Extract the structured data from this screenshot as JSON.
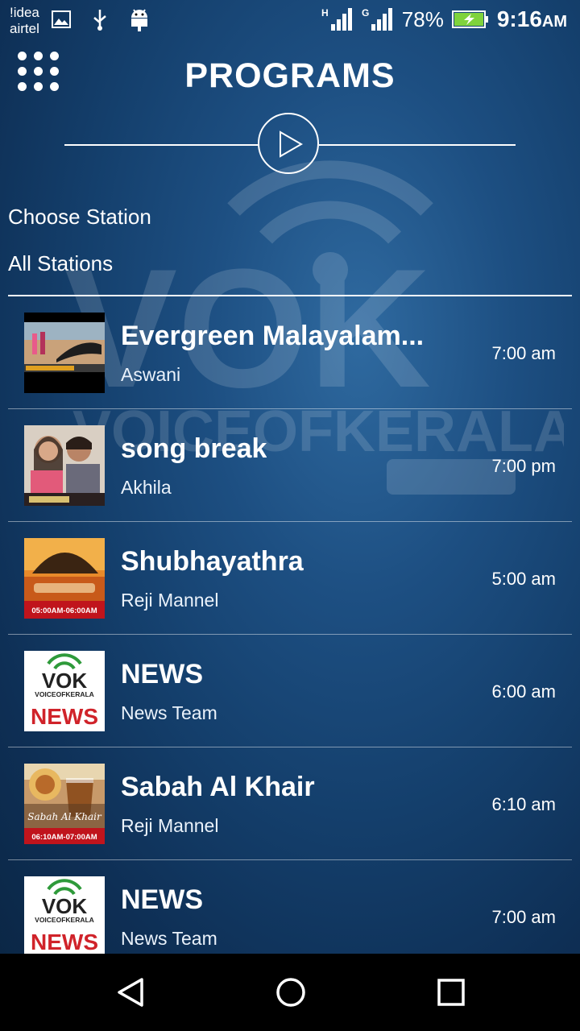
{
  "status_bar": {
    "carrier_line1": "!idea",
    "carrier_line2": "airtel",
    "network1": "H",
    "network2": "G",
    "battery_percent": "78%",
    "time": "9:16",
    "am_pm": "AM"
  },
  "header": {
    "title": "PROGRAMS"
  },
  "station": {
    "choose_label": "Choose Station",
    "selected": "All Stations"
  },
  "thumb_text": {
    "shubhayathra_time": "05:00AM-06:00AM",
    "sabah_time": "06:10AM-07:00AM",
    "sabah_name": "Sabah Al Khair",
    "vok_logo": "VOK",
    "vok_sub": "VOICEOFKERALA",
    "news_word": "NEWS"
  },
  "programs": [
    {
      "title": "Evergreen Malayalam...",
      "host": "Aswani",
      "time": "7:00 am",
      "thumb": "evergreen"
    },
    {
      "title": "song break",
      "host": "Akhila",
      "time": "7:00 pm",
      "thumb": "movie"
    },
    {
      "title": "Shubhayathra",
      "host": "Reji Mannel",
      "time": "5:00 am",
      "thumb": "shubhayathra"
    },
    {
      "title": "NEWS",
      "host": "News Team",
      "time": "6:00 am",
      "thumb": "news"
    },
    {
      "title": "Sabah Al Khair",
      "host": "Reji Mannel",
      "time": "6:10 am",
      "thumb": "sabah"
    },
    {
      "title": "NEWS",
      "host": "News Team",
      "time": "7:00 am",
      "thumb": "news"
    }
  ],
  "colors": {
    "background": "#1d4f82",
    "accent_red": "#d0232a",
    "vok_green": "#2e9a3a"
  }
}
